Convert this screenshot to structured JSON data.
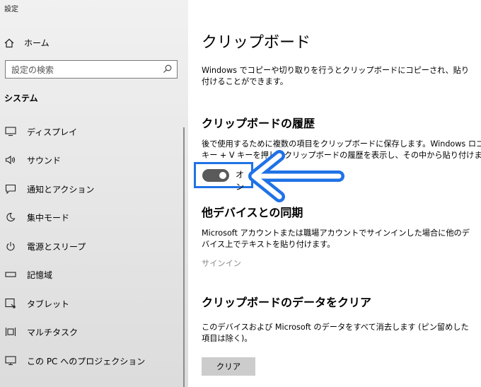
{
  "window": {
    "title": "設定"
  },
  "sidebar": {
    "home_label": "ホーム",
    "search_placeholder": "設定の検索",
    "section_label": "システム",
    "items": [
      {
        "label": "ディスプレイ",
        "icon": "display-icon"
      },
      {
        "label": "サウンド",
        "icon": "speaker-icon"
      },
      {
        "label": "通知とアクション",
        "icon": "notification-icon"
      },
      {
        "label": "集中モード",
        "icon": "moon-icon"
      },
      {
        "label": "電源とスリープ",
        "icon": "power-icon"
      },
      {
        "label": "記憶域",
        "icon": "storage-icon"
      },
      {
        "label": "タブレット",
        "icon": "tablet-icon"
      },
      {
        "label": "マルチタスク",
        "icon": "multitask-icon"
      },
      {
        "label": "この PC へのプロジェクション",
        "icon": "projection-icon"
      }
    ]
  },
  "main": {
    "title": "クリップボード",
    "description": "Windows でコピーや切り取りを行うとクリップボードにコピーされ、貼り付けることができます。",
    "history": {
      "heading": "クリップボードの履歴",
      "description_line1": "後で使用するために複数の項目をクリップボードに保存します。Windows ロゴ",
      "description_line2": "キー + V キーを押してクリップボードの履歴を表示し、その中から貼り付けます。",
      "toggle_state": "オン"
    },
    "sync": {
      "heading": "他デバイスとの同期",
      "description": "Microsoft アカウントまたは職場アカウントでサインインした場合に他のデバイス上でテキストを貼り付けます。",
      "signin_link": "サインイン"
    },
    "clear": {
      "heading": "クリップボードのデータをクリア",
      "description": "このデバイスおよび Microsoft のデータをすべて消去します (ピン留めした項目は除く)。",
      "button_label": "クリア"
    }
  },
  "colors": {
    "accent": "#1f72e6",
    "toggle_on": "#5a5a5a",
    "sidebar_bg": "#e6e6e6"
  }
}
